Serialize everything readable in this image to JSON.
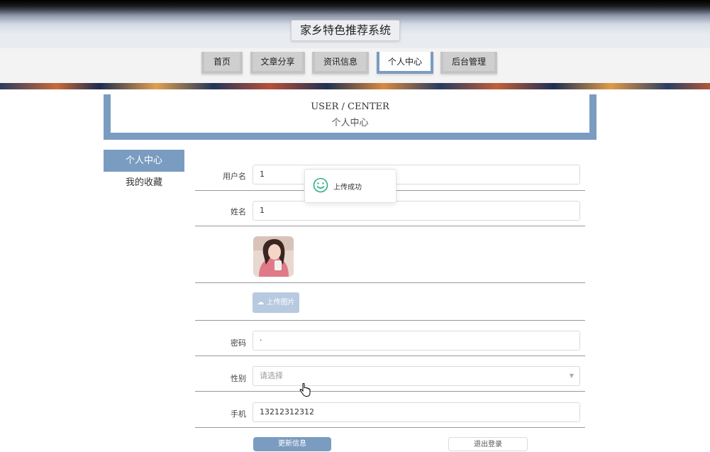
{
  "header": {
    "title": "家乡特色推荐系统"
  },
  "nav": {
    "items": [
      {
        "label": "首页"
      },
      {
        "label": "文章分享"
      },
      {
        "label": "资讯信息"
      },
      {
        "label": "个人中心"
      },
      {
        "label": "后台管理"
      }
    ],
    "active_index": 3
  },
  "banner": {
    "title_en": "USER / CENTER",
    "title_cn": "个人中心"
  },
  "sidebar": {
    "items": [
      {
        "label": "个人中心",
        "active": true
      },
      {
        "label": "我的收藏",
        "active": false
      }
    ]
  },
  "form": {
    "username": {
      "label": "用户名",
      "value": "1"
    },
    "name": {
      "label": "姓名",
      "value": "1"
    },
    "upload_button": {
      "label": "上传图片",
      "icon": "cloud-upload-icon"
    },
    "password": {
      "label": "密码",
      "value": "·"
    },
    "gender": {
      "label": "性别",
      "placeholder": "请选择"
    },
    "phone": {
      "label": "手机",
      "value": "13212312312"
    }
  },
  "actions": {
    "save_label": "更新信息",
    "logout_label": "退出登录"
  },
  "toast": {
    "message": "上传成功",
    "icon": "smile-icon"
  },
  "colors": {
    "accent": "#7b9cc1",
    "upload_button": "#b7cadf",
    "toast_icon": "#2eb07d"
  }
}
